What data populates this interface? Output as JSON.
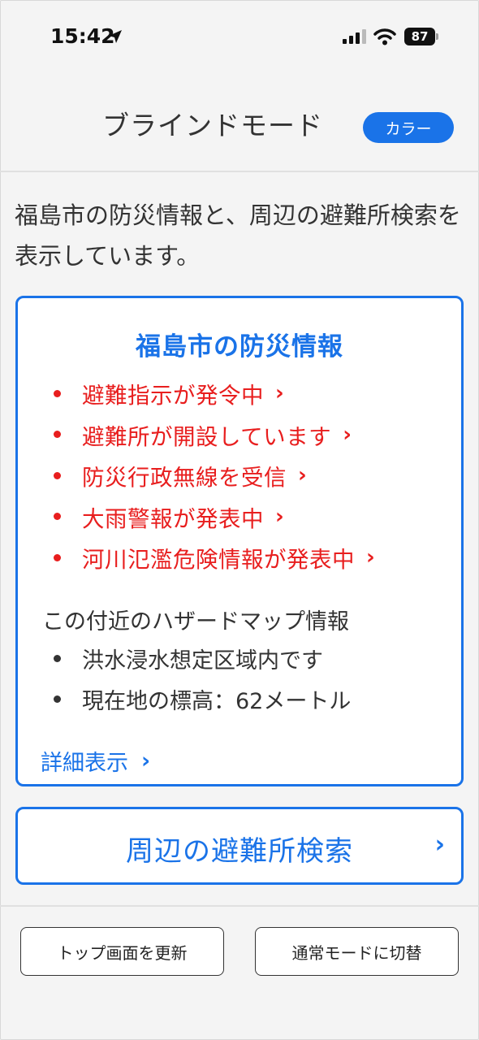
{
  "status_bar": {
    "time": "15:42",
    "battery": "87",
    "icons": [
      "location-arrow-icon",
      "signal-icon",
      "wifi-icon",
      "battery-icon"
    ]
  },
  "header": {
    "title": "ブラインドモード",
    "color_button": "カラー"
  },
  "intro": "福島市の防災情報と、周辺の避難所検索を表示しています。",
  "info_card": {
    "title": "福島市の防災情報",
    "alerts": [
      "避難指示が発令中",
      "避難所が開設しています",
      "防災行政無線を受信",
      "大雨警報が発表中",
      "河川氾濫危険情報が発表中"
    ],
    "hazard_heading": "この付近のハザードマップ情報",
    "hazard_items": [
      "洪水浸水想定区域内です",
      "現在地の標高：62メートル"
    ],
    "detail_link": "詳細表示",
    "chevron": "›"
  },
  "shelter_search": "周辺の避難所検索",
  "bottom": {
    "refresh": "トップ画面を更新",
    "switch_mode": "通常モードに切替"
  },
  "colors": {
    "accent": "#1a73e8",
    "alert": "#e81e1e",
    "text": "#333333",
    "background": "#f4f4f4"
  }
}
